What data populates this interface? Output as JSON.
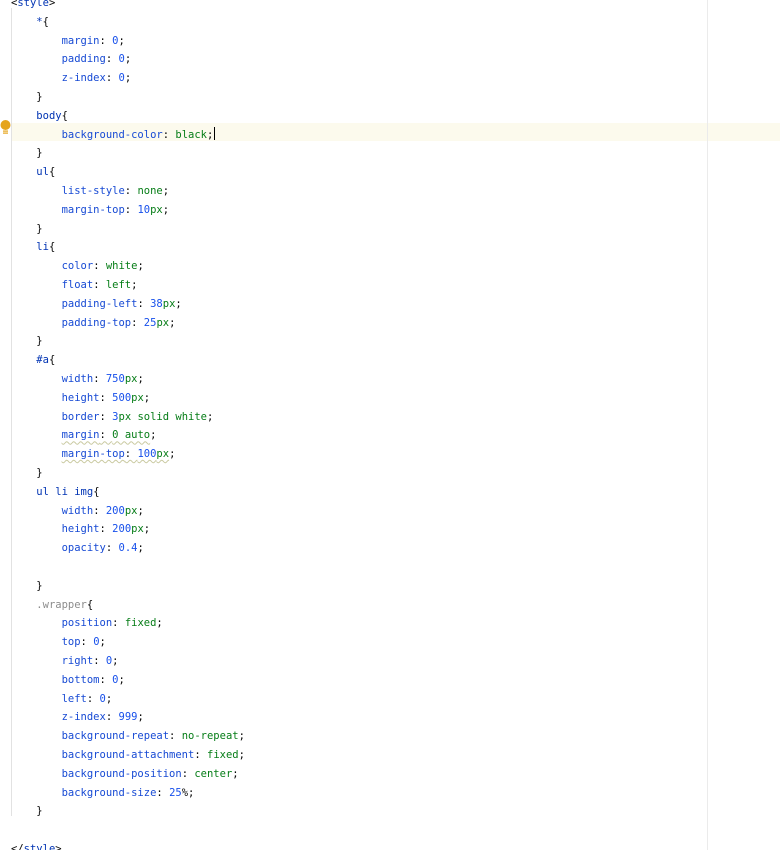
{
  "editor": {
    "language": "CSS",
    "colors": {
      "background": "#ffffff",
      "current_line": "#fcfaed",
      "selector": "#0033b3",
      "property": "#174ad4",
      "value": "#067d17",
      "number": "#1750eb",
      "unused_selector": "#8c8c8c",
      "bulb": "#e5a41b"
    },
    "gutter_icon": "lightbulb-icon",
    "lines": [
      [
        {
          "t": "<",
          "c": "angle"
        },
        {
          "t": "style",
          "c": "tag"
        },
        {
          "t": ">",
          "c": "angle"
        }
      ],
      [
        {
          "t": "    "
        },
        {
          "t": "*",
          "c": "sel"
        },
        {
          "t": "{",
          "c": "punct"
        }
      ],
      [
        {
          "t": "        "
        },
        {
          "t": "margin",
          "c": "prop"
        },
        {
          "t": ": ",
          "c": "punct"
        },
        {
          "t": "0",
          "c": "num"
        },
        {
          "t": ";",
          "c": "punct"
        }
      ],
      [
        {
          "t": "        "
        },
        {
          "t": "padding",
          "c": "prop"
        },
        {
          "t": ": ",
          "c": "punct"
        },
        {
          "t": "0",
          "c": "num"
        },
        {
          "t": ";",
          "c": "punct"
        }
      ],
      [
        {
          "t": "        "
        },
        {
          "t": "z-index",
          "c": "prop"
        },
        {
          "t": ": ",
          "c": "punct"
        },
        {
          "t": "0",
          "c": "num"
        },
        {
          "t": ";",
          "c": "punct"
        }
      ],
      [
        {
          "t": "    "
        },
        {
          "t": "}",
          "c": "punct"
        }
      ],
      [
        {
          "t": "    "
        },
        {
          "t": "body",
          "c": "sel"
        },
        {
          "t": "{",
          "c": "punct"
        }
      ],
      [
        {
          "t": "        "
        },
        {
          "t": "background-color",
          "c": "prop"
        },
        {
          "t": ": ",
          "c": "punct"
        },
        {
          "t": "black",
          "c": "val"
        },
        {
          "t": ";",
          "c": "punct"
        },
        {
          "t": "",
          "c": "caret"
        }
      ],
      [
        {
          "t": "    "
        },
        {
          "t": "}",
          "c": "punct"
        }
      ],
      [
        {
          "t": "    "
        },
        {
          "t": "ul",
          "c": "sel"
        },
        {
          "t": "{",
          "c": "punct"
        }
      ],
      [
        {
          "t": "        "
        },
        {
          "t": "list-style",
          "c": "prop"
        },
        {
          "t": ": ",
          "c": "punct"
        },
        {
          "t": "none",
          "c": "val"
        },
        {
          "t": ";",
          "c": "punct"
        }
      ],
      [
        {
          "t": "        "
        },
        {
          "t": "margin-top",
          "c": "prop"
        },
        {
          "t": ": ",
          "c": "punct"
        },
        {
          "t": "10",
          "c": "num"
        },
        {
          "t": "px",
          "c": "unit"
        },
        {
          "t": ";",
          "c": "punct"
        }
      ],
      [
        {
          "t": "    "
        },
        {
          "t": "}",
          "c": "punct"
        }
      ],
      [
        {
          "t": "    "
        },
        {
          "t": "li",
          "c": "sel"
        },
        {
          "t": "{",
          "c": "punct"
        }
      ],
      [
        {
          "t": "        "
        },
        {
          "t": "color",
          "c": "prop"
        },
        {
          "t": ": ",
          "c": "punct"
        },
        {
          "t": "white",
          "c": "val"
        },
        {
          "t": ";",
          "c": "punct"
        }
      ],
      [
        {
          "t": "        "
        },
        {
          "t": "float",
          "c": "prop"
        },
        {
          "t": ": ",
          "c": "punct"
        },
        {
          "t": "left",
          "c": "val"
        },
        {
          "t": ";",
          "c": "punct"
        }
      ],
      [
        {
          "t": "        "
        },
        {
          "t": "padding-left",
          "c": "prop"
        },
        {
          "t": ": ",
          "c": "punct"
        },
        {
          "t": "38",
          "c": "num"
        },
        {
          "t": "px",
          "c": "unit"
        },
        {
          "t": ";",
          "c": "punct"
        }
      ],
      [
        {
          "t": "        "
        },
        {
          "t": "padding-top",
          "c": "prop"
        },
        {
          "t": ": ",
          "c": "punct"
        },
        {
          "t": "25",
          "c": "num"
        },
        {
          "t": "px",
          "c": "unit"
        },
        {
          "t": ";",
          "c": "punct"
        }
      ],
      [
        {
          "t": "    "
        },
        {
          "t": "}",
          "c": "punct"
        }
      ],
      [
        {
          "t": "    "
        },
        {
          "t": "#a",
          "c": "sel"
        },
        {
          "t": "{",
          "c": "punct"
        }
      ],
      [
        {
          "t": "        "
        },
        {
          "t": "width",
          "c": "prop"
        },
        {
          "t": ": ",
          "c": "punct"
        },
        {
          "t": "750",
          "c": "num"
        },
        {
          "t": "px",
          "c": "unit"
        },
        {
          "t": ";",
          "c": "punct"
        }
      ],
      [
        {
          "t": "        "
        },
        {
          "t": "height",
          "c": "prop"
        },
        {
          "t": ": ",
          "c": "punct"
        },
        {
          "t": "500",
          "c": "num"
        },
        {
          "t": "px",
          "c": "unit"
        },
        {
          "t": ";",
          "c": "punct"
        }
      ],
      [
        {
          "t": "        "
        },
        {
          "t": "border",
          "c": "prop"
        },
        {
          "t": ": ",
          "c": "punct"
        },
        {
          "t": "3",
          "c": "num"
        },
        {
          "t": "px solid white",
          "c": "val"
        },
        {
          "t": ";",
          "c": "punct"
        }
      ],
      [
        {
          "t": "        "
        },
        {
          "t": "margin",
          "c": "prop warn"
        },
        {
          "t": ": ",
          "c": "punct warn"
        },
        {
          "t": "0 auto",
          "c": "val warn"
        },
        {
          "t": ";",
          "c": "punct"
        }
      ],
      [
        {
          "t": "        "
        },
        {
          "t": "margin-top",
          "c": "prop warn"
        },
        {
          "t": ": ",
          "c": "punct warn"
        },
        {
          "t": "100",
          "c": "num warn"
        },
        {
          "t": "px",
          "c": "unit warn"
        },
        {
          "t": ";",
          "c": "punct"
        }
      ],
      [
        {
          "t": "    "
        },
        {
          "t": "}",
          "c": "punct"
        }
      ],
      [
        {
          "t": "    "
        },
        {
          "t": "ul li img",
          "c": "sel"
        },
        {
          "t": "{",
          "c": "punct"
        }
      ],
      [
        {
          "t": "        "
        },
        {
          "t": "width",
          "c": "prop"
        },
        {
          "t": ": ",
          "c": "punct"
        },
        {
          "t": "200",
          "c": "num"
        },
        {
          "t": "px",
          "c": "unit"
        },
        {
          "t": ";",
          "c": "punct"
        }
      ],
      [
        {
          "t": "        "
        },
        {
          "t": "height",
          "c": "prop"
        },
        {
          "t": ": ",
          "c": "punct"
        },
        {
          "t": "200",
          "c": "num"
        },
        {
          "t": "px",
          "c": "unit"
        },
        {
          "t": ";",
          "c": "punct"
        }
      ],
      [
        {
          "t": "        "
        },
        {
          "t": "opacity",
          "c": "prop"
        },
        {
          "t": ": ",
          "c": "punct"
        },
        {
          "t": "0.4",
          "c": "num"
        },
        {
          "t": ";",
          "c": "punct"
        }
      ],
      [
        {
          "t": ""
        }
      ],
      [
        {
          "t": "    "
        },
        {
          "t": "}",
          "c": "punct"
        }
      ],
      [
        {
          "t": "    "
        },
        {
          "t": ".wrapper",
          "c": "sel-unused"
        },
        {
          "t": "{",
          "c": "punct"
        }
      ],
      [
        {
          "t": "        "
        },
        {
          "t": "position",
          "c": "prop"
        },
        {
          "t": ": ",
          "c": "punct"
        },
        {
          "t": "fixed",
          "c": "val"
        },
        {
          "t": ";",
          "c": "punct"
        }
      ],
      [
        {
          "t": "        "
        },
        {
          "t": "top",
          "c": "prop"
        },
        {
          "t": ": ",
          "c": "punct"
        },
        {
          "t": "0",
          "c": "num"
        },
        {
          "t": ";",
          "c": "punct"
        }
      ],
      [
        {
          "t": "        "
        },
        {
          "t": "right",
          "c": "prop"
        },
        {
          "t": ": ",
          "c": "punct"
        },
        {
          "t": "0",
          "c": "num"
        },
        {
          "t": ";",
          "c": "punct"
        }
      ],
      [
        {
          "t": "        "
        },
        {
          "t": "bottom",
          "c": "prop"
        },
        {
          "t": ": ",
          "c": "punct"
        },
        {
          "t": "0",
          "c": "num"
        },
        {
          "t": ";",
          "c": "punct"
        }
      ],
      [
        {
          "t": "        "
        },
        {
          "t": "left",
          "c": "prop"
        },
        {
          "t": ": ",
          "c": "punct"
        },
        {
          "t": "0",
          "c": "num"
        },
        {
          "t": ";",
          "c": "punct"
        }
      ],
      [
        {
          "t": "        "
        },
        {
          "t": "z-index",
          "c": "prop"
        },
        {
          "t": ": ",
          "c": "punct"
        },
        {
          "t": "999",
          "c": "num"
        },
        {
          "t": ";",
          "c": "punct"
        }
      ],
      [
        {
          "t": "        "
        },
        {
          "t": "background-repeat",
          "c": "prop"
        },
        {
          "t": ": ",
          "c": "punct"
        },
        {
          "t": "no-repeat",
          "c": "val"
        },
        {
          "t": ";",
          "c": "punct"
        }
      ],
      [
        {
          "t": "        "
        },
        {
          "t": "background-attachment",
          "c": "prop"
        },
        {
          "t": ": ",
          "c": "punct"
        },
        {
          "t": "fixed",
          "c": "val"
        },
        {
          "t": ";",
          "c": "punct"
        }
      ],
      [
        {
          "t": "        "
        },
        {
          "t": "background-position",
          "c": "prop"
        },
        {
          "t": ": ",
          "c": "punct"
        },
        {
          "t": "center",
          "c": "val"
        },
        {
          "t": ";",
          "c": "punct"
        }
      ],
      [
        {
          "t": "        "
        },
        {
          "t": "background-size",
          "c": "prop"
        },
        {
          "t": ": ",
          "c": "punct"
        },
        {
          "t": "25",
          "c": "num"
        },
        {
          "t": "%",
          "c": "punct"
        },
        {
          "t": ";",
          "c": "punct"
        }
      ],
      [
        {
          "t": "    "
        },
        {
          "t": "}",
          "c": "punct"
        }
      ],
      [
        {
          "t": ""
        }
      ],
      [
        {
          "t": "</",
          "c": "angle"
        },
        {
          "t": "style",
          "c": "tag"
        },
        {
          "t": ">",
          "c": "angle"
        }
      ]
    ]
  }
}
